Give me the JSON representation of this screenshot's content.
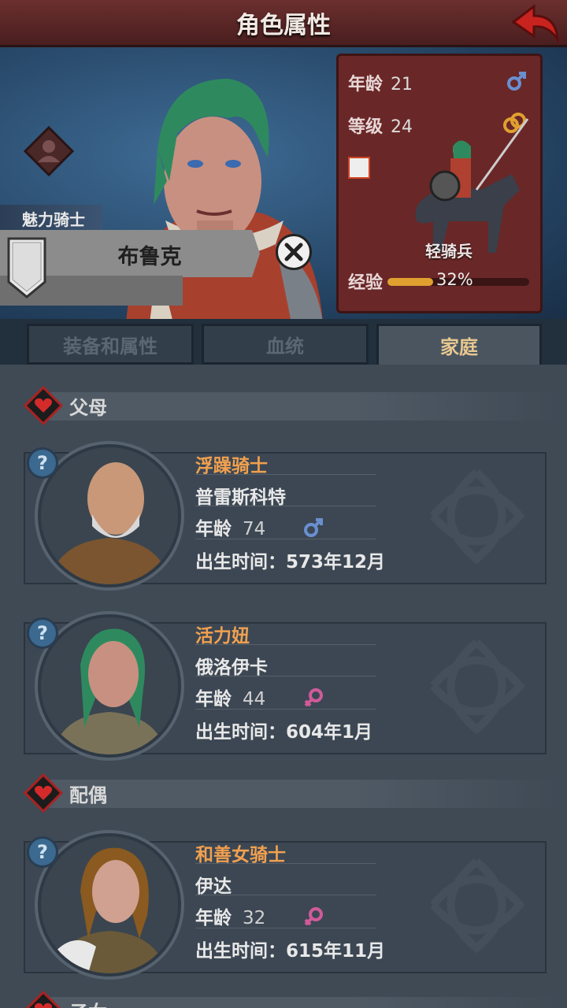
{
  "header": {
    "title": "角色属性"
  },
  "hero": {
    "title_tag": "魅力骑士",
    "name": "布鲁克",
    "info": {
      "age_label": "年龄",
      "age": "21",
      "level_label": "等级",
      "level": "24",
      "unit_name": "轻骑兵",
      "exp_label": "经验",
      "exp_percent": "32%",
      "exp_fraction": 0.32
    }
  },
  "tabs": [
    {
      "label": "装备和属性"
    },
    {
      "label": "血统"
    },
    {
      "label": "家庭"
    }
  ],
  "sections": {
    "parents": "父母",
    "spouse": "配偶",
    "children": "子女"
  },
  "cards": [
    {
      "trait": "浮躁骑士",
      "name": "普雷斯科特",
      "age_label": "年龄",
      "age": "74",
      "gender": "male",
      "birth": "出生时间：573年12月"
    },
    {
      "trait": "活力妞",
      "name": "俄洛伊卡",
      "age_label": "年龄",
      "age": "44",
      "gender": "female",
      "birth": "出生时间：604年1月"
    },
    {
      "trait": "和善女骑士",
      "name": "伊达",
      "age_label": "年龄",
      "age": "32",
      "gender": "female",
      "birth": "出生时间：615年11月"
    }
  ],
  "colors": {
    "accent": "#f0a050",
    "male": "#6a8fd0",
    "female": "#d05a9a",
    "banner": "#6a2727"
  }
}
